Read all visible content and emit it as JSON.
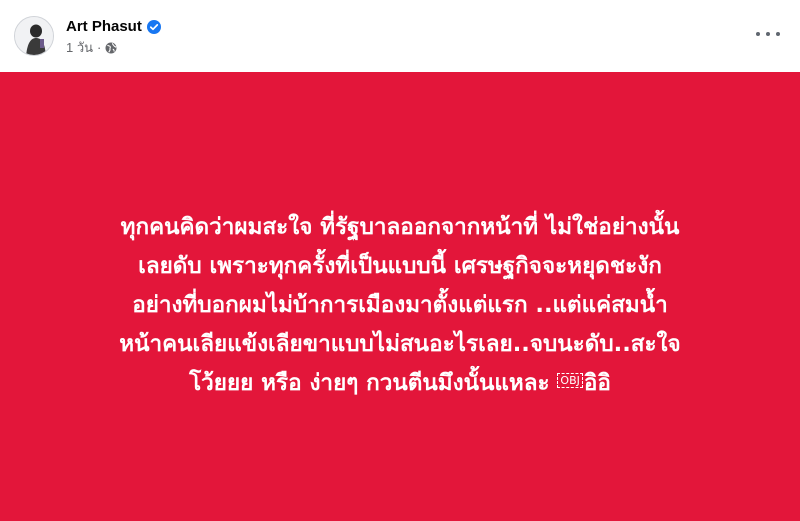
{
  "post": {
    "author": "Art Phasut",
    "verified_icon": "verified-badge-icon",
    "timestamp": "1 วัน",
    "separator": "·",
    "audience_icon": "globe-icon",
    "more_icon": "more-options-icon"
  },
  "banner": {
    "background_color": "#e3163a",
    "text_color": "#ffffff",
    "lines": [
      "ทุกคนคิดว่าผมสะใจ ที่รัฐบาลออกจากหน้าที่ ไม่ใช่อย่างนั้น",
      "เลยดับ เพราะทุกครั้งที่เป็นแบบนี้ เศรษฐกิจจะหยุดชะงัก",
      "อย่างที่บอกผมไม่บ้าการเมืองมาตั้งแต่แรก ..แต่แค่สมน้ำ",
      "หน้าคนเลียแข้งเลียขาแบบไม่สนอะไรเลย..จบนะดับ..สะใจ",
      "โว้ยยย หรือ ง่ายๆ กวนตีนมึงนั้นแหละ "
    ],
    "obj_glyph": "OBJ",
    "last_line_suffix": "อิอิ"
  }
}
